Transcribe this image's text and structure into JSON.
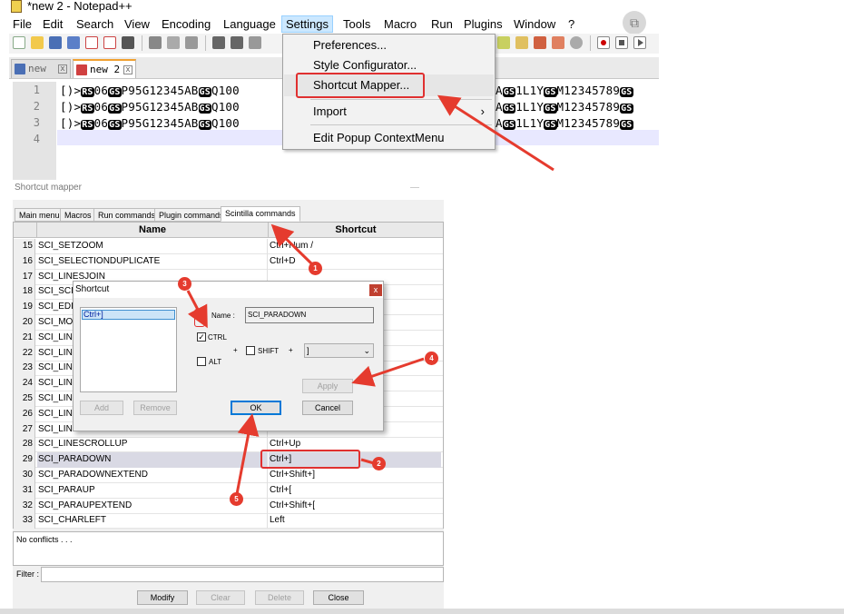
{
  "window": {
    "title": "*new 2 - Notepad++"
  },
  "menu": [
    "File",
    "Edit",
    "Search",
    "View",
    "Encoding",
    "Language",
    "Settings",
    "Tools",
    "Macro",
    "Run",
    "Plugins",
    "Window",
    "?"
  ],
  "tabs": [
    {
      "label": "new 1",
      "close": "x"
    },
    {
      "label": "new 2",
      "close": "x"
    }
  ],
  "editor": {
    "line_numbers": [
      "1",
      "2",
      "3",
      "4"
    ],
    "lines": [
      {
        "pre": "[)>",
        "rs": "RS",
        "mid": "06",
        "gs1": "GS",
        "text1": "P95G12345AB",
        "gs2": "GS",
        "text2": "Q100",
        "tail_gs1": "GS",
        "tail1": "1L1Y",
        "tail_gs2": "GS",
        "tail2": "M12345789",
        "tail_gs3": "GS"
      },
      {
        "pre": "[)>",
        "rs": "RS",
        "mid": "06",
        "gs1": "GS",
        "text1": "P95G12345AB",
        "gs2": "GS",
        "text2": "Q100",
        "tail_gs1": "GS",
        "tail1": "1L1Y",
        "tail_gs2": "GS",
        "tail2": "M12345789",
        "tail_gs3": "GS"
      },
      {
        "pre": "[)>",
        "rs": "RS",
        "mid": "06",
        "gs1": "GS",
        "text1": "P95G12345AB",
        "gs2": "GS",
        "text2": "Q100",
        "tail_gs1": "GS",
        "tail1": "1L1Y",
        "tail_gs2": "GS",
        "tail2": "M12345789",
        "tail_gs3": "GS"
      }
    ],
    "tail_prefix": "A"
  },
  "settings_menu": {
    "items": [
      "Preferences...",
      "Style Configurator...",
      "Shortcut Mapper...",
      "Import",
      "Edit Popup ContextMenu"
    ],
    "submenu_arrow": "›"
  },
  "shortcut_mapper": {
    "caption": "Shortcut mapper",
    "tabs": [
      "Main menu",
      "Macros",
      "Run commands",
      "Plugin commands",
      "Scintilla commands"
    ],
    "columns": [
      "Name",
      "Shortcut"
    ],
    "rows": [
      {
        "num": "15",
        "name": "SCI_SETZOOM",
        "shortcut": "Ctrl+Num /"
      },
      {
        "num": "16",
        "name": "SCI_SELECTIONDUPLICATE",
        "shortcut": "Ctrl+D"
      },
      {
        "num": "17",
        "name": "SCI_LINESJOIN",
        "shortcut": ""
      },
      {
        "num": "18",
        "name": "SCI_SCI",
        "shortcut": ""
      },
      {
        "num": "19",
        "name": "SCI_EDI",
        "shortcut": ""
      },
      {
        "num": "20",
        "name": "SCI_MO",
        "shortcut": ""
      },
      {
        "num": "21",
        "name": "SCI_LIN",
        "shortcut": ""
      },
      {
        "num": "22",
        "name": "SCI_LIN",
        "shortcut": ""
      },
      {
        "num": "23",
        "name": "SCI_LIN",
        "shortcut": ""
      },
      {
        "num": "24",
        "name": "SCI_LIN",
        "shortcut": ""
      },
      {
        "num": "25",
        "name": "SCI_LIN",
        "shortcut": ""
      },
      {
        "num": "26",
        "name": "SCI_LIN",
        "shortcut": ""
      },
      {
        "num": "27",
        "name": "SCI_LIN",
        "shortcut": ""
      },
      {
        "num": "28",
        "name": "SCI_LINESCROLLUP",
        "shortcut": "Ctrl+Up"
      },
      {
        "num": "29",
        "name": "SCI_PARADOWN",
        "shortcut": "Ctrl+]"
      },
      {
        "num": "30",
        "name": "SCI_PARADOWNEXTEND",
        "shortcut": "Ctrl+Shift+]"
      },
      {
        "num": "31",
        "name": "SCI_PARAUP",
        "shortcut": "Ctrl+["
      },
      {
        "num": "32",
        "name": "SCI_PARAUPEXTEND",
        "shortcut": "Ctrl+Shift+["
      },
      {
        "num": "33",
        "name": "SCI_CHARLEFT",
        "shortcut": "Left"
      }
    ],
    "selected_row": "29",
    "conflicts": "No conflicts . . .",
    "filter_label": "Filter :",
    "buttons": [
      "Modify",
      "Clear",
      "Delete",
      "Close"
    ]
  },
  "shortcut_dialog": {
    "title": "Shortcut",
    "close": "x",
    "list_item": "Ctrl+]",
    "name_label": "Name :",
    "name_value": "SCI_PARADOWN",
    "ctrl_label": "CTRL",
    "ctrl_checked": "✓",
    "alt_label": "ALT",
    "shift_label": "SHIFT",
    "plus": "+",
    "key_value": "]",
    "buttons": {
      "add": "Add",
      "remove": "Remove",
      "apply": "Apply",
      "ok": "OK",
      "cancel": "Cancel"
    }
  },
  "annotations": [
    "1",
    "2",
    "3",
    "4",
    "5"
  ],
  "colors": {
    "annotation_red": "#e53b2e",
    "menu_highlight": "#cce8ff",
    "selected_row": "#d9d9e4"
  }
}
